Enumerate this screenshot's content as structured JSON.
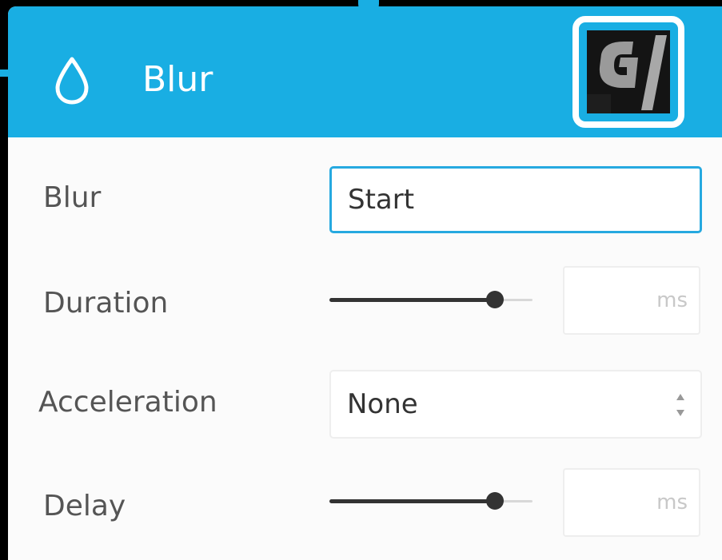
{
  "panel": {
    "title": "Blur",
    "icon": "drop-icon",
    "thumbnail": "g-logo-thumbnail"
  },
  "colors": {
    "accent": "#19aee3",
    "panel_bg": "#fbfbfb",
    "label": "#555555"
  },
  "fields": {
    "blur": {
      "label": "Blur",
      "value": "Start"
    },
    "duration": {
      "label": "Duration",
      "slider_level": 0.82,
      "value": "",
      "unit": "ms"
    },
    "acceleration": {
      "label": "Acceleration",
      "selected": "None"
    },
    "delay": {
      "label": "Delay",
      "slider_level": 0.82,
      "value": "",
      "unit": "ms"
    }
  }
}
